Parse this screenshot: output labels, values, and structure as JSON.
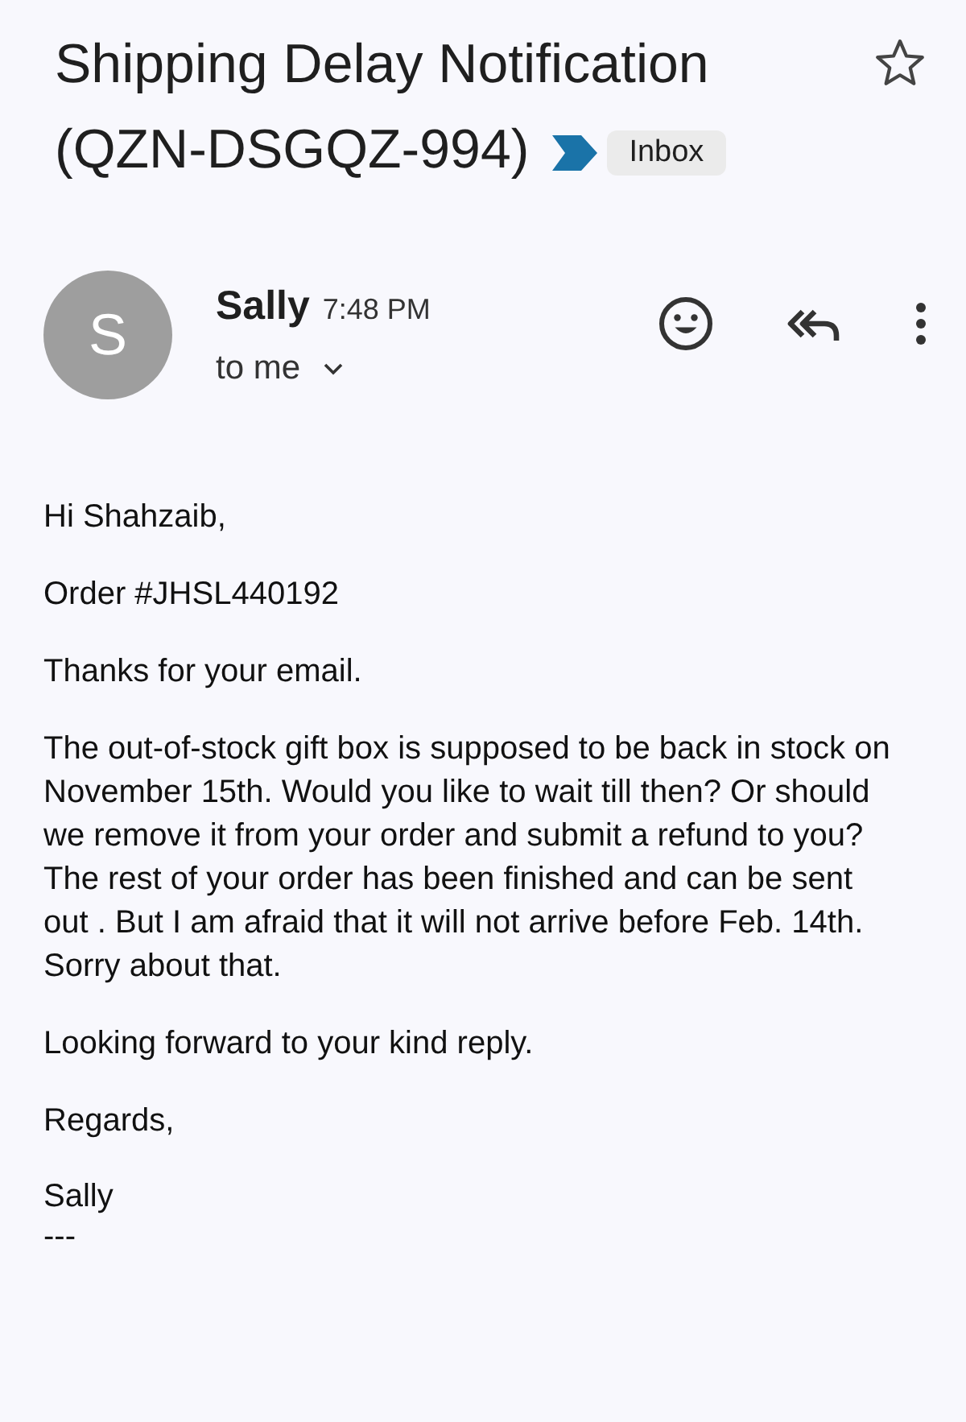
{
  "subject": "Shipping Delay Notification (QZN-DSGQZ-994)",
  "important": true,
  "label": "Inbox",
  "starred": false,
  "sender": {
    "initial": "S",
    "name": "Sally",
    "time": "7:48 PM",
    "recipient": "to me"
  },
  "body": [
    "Hi Shahzaib,",
    "Order #JHSL440192",
    "Thanks for your email.",
    "The out-of-stock gift box is supposed to be back in stock on November 15th. Would you like to wait till then? Or should we remove it from your order and submit a refund to you? The rest of your order has been finished and can be sent out . But I am afraid that it will not arrive before Feb. 14th. Sorry about that.",
    "Looking forward to your kind reply.",
    "Regards,"
  ],
  "signature": [
    "Sally",
    "---"
  ]
}
